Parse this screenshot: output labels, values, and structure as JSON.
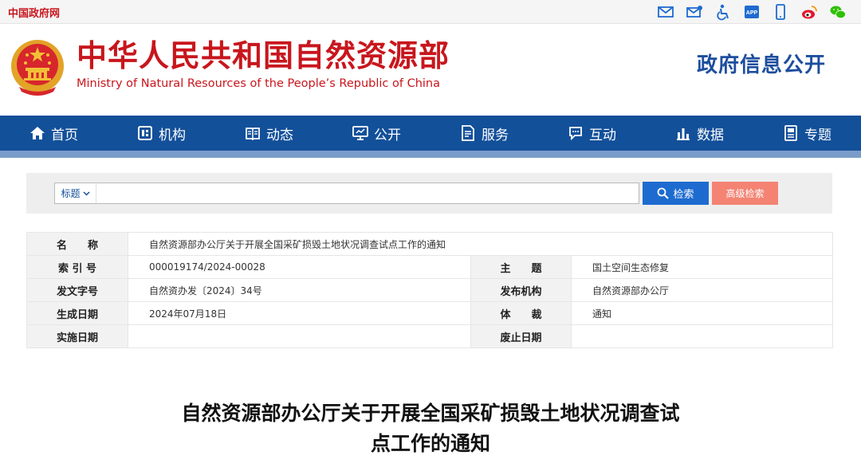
{
  "topbar": {
    "gov_link": "中国政府网",
    "icons": [
      "mail-icon",
      "mail-edit-icon",
      "accessibility-icon",
      "app-icon",
      "mobile-icon",
      "weibo-icon",
      "wechat-icon"
    ],
    "app_text": "APP"
  },
  "header": {
    "title": "中华人民共和国自然资源部",
    "subtitle": "Ministry of Natural Resources of the People’s Republic of China",
    "section": "政府信息公开"
  },
  "nav": {
    "items": [
      {
        "label": "首页",
        "icon": "home-icon"
      },
      {
        "label": "机构",
        "icon": "org-icon"
      },
      {
        "label": "动态",
        "icon": "book-icon"
      },
      {
        "label": "公开",
        "icon": "monitor-icon"
      },
      {
        "label": "服务",
        "icon": "form-icon"
      },
      {
        "label": "互动",
        "icon": "chat-icon"
      },
      {
        "label": "数据",
        "icon": "chart-icon"
      },
      {
        "label": "专题",
        "icon": "document-icon"
      }
    ]
  },
  "search": {
    "select_value": "标题",
    "input_value": "",
    "search_label": "检索",
    "advanced_label": "高级检索"
  },
  "info": {
    "name_label": "名　　称",
    "name_value": "自然资源部办公厅关于开展全国采矿损毁土地状况调查试点工作的通知",
    "index_label": "索 引 号",
    "index_value": "000019174/2024-00028",
    "topic_label": "主　　题",
    "topic_value": "国土空间生态修复",
    "docno_label": "发文字号",
    "docno_value": "自然资办发〔2024〕34号",
    "issuer_label": "发布机构",
    "issuer_value": "自然资源部办公厅",
    "date_label": "生成日期",
    "date_value": "2024年07月18日",
    "genre_label": "体　　裁",
    "genre_value": "通知",
    "effective_label": "实施日期",
    "effective_value": "",
    "expiry_label": "废止日期",
    "expiry_value": ""
  },
  "document": {
    "title_line1": "自然资源部办公厅关于开展全国采矿损毁土地状况调查试",
    "title_line2": "点工作的通知"
  },
  "colors": {
    "brand_red": "#c8161d",
    "nav_blue": "#13509a",
    "search_blue": "#1e6bd0",
    "advanced_orange": "#f48373"
  }
}
